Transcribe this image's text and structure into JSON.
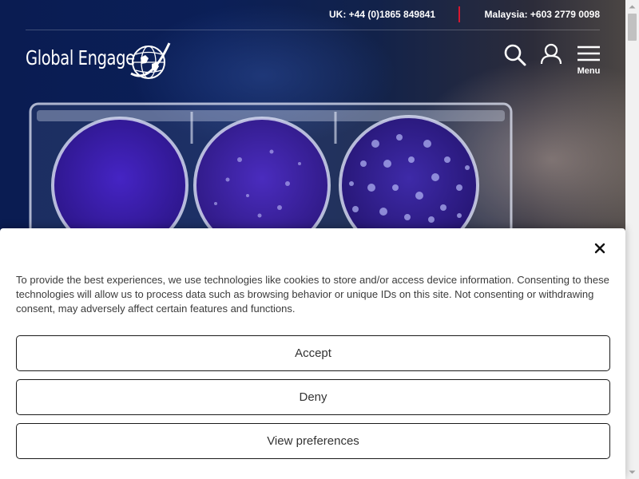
{
  "header": {
    "contacts": {
      "uk": "UK: +44 (0)1865 849841",
      "malaysia": "Malaysia: +603 2779 0098"
    },
    "logo_text": "Global Engage",
    "menu_label": "Menu",
    "icons": [
      "search-icon",
      "user-icon",
      "hamburger-menu-icon",
      "globe-icon"
    ]
  },
  "hero": {
    "image": "petri-dish-plate-photo"
  },
  "cookie_banner": {
    "message": "To provide the best experiences, we use technologies like cookies to store and/or access device information. Consenting to these technologies will allow us to process data such as browsing behavior or unique IDs on this site. Not consenting or withdrawing consent, may adversely affect certain features and functions.",
    "accept_label": "Accept",
    "deny_label": "Deny",
    "preferences_label": "View preferences",
    "close_icon": "close-icon"
  },
  "colors": {
    "accent_red": "#d7172f",
    "hero_navy": "#0b1f57",
    "plate_purple": "#3a1aa8",
    "banner_bg": "#ffffff"
  }
}
